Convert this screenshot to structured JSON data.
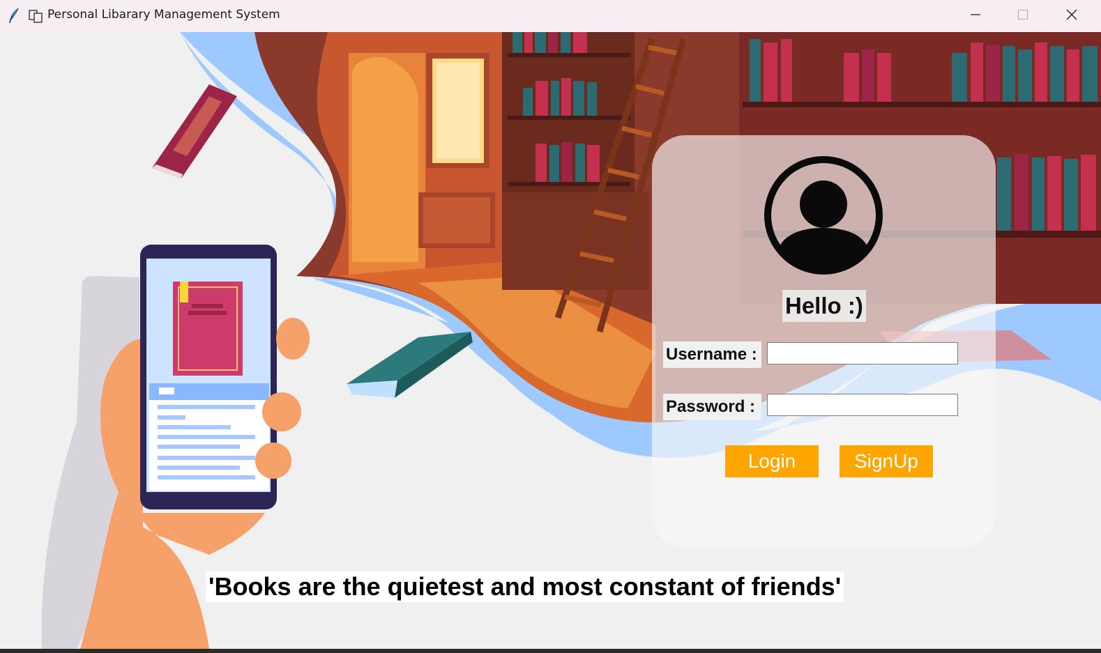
{
  "window": {
    "title": "Personal Libarary Management System",
    "icons": {
      "app": "feather-icon",
      "snap": "snap-layout-icon",
      "minimize": "minimize-icon",
      "maximize": "maximize-icon",
      "close": "close-icon"
    }
  },
  "login": {
    "greeting": "Hello :)",
    "username_label": "Username :",
    "password_label": "Password :",
    "username_value": "",
    "password_value": "",
    "login_label": "Login",
    "signup_label": "SignUp",
    "avatar_icon": "user-avatar-icon"
  },
  "quote": "'Books are the quietest and most constant of friends'",
  "colors": {
    "button": "#ffa500",
    "button_text": "#ffffff",
    "background": "#f0f0f0",
    "accent_blue": "#9ec9ff"
  }
}
